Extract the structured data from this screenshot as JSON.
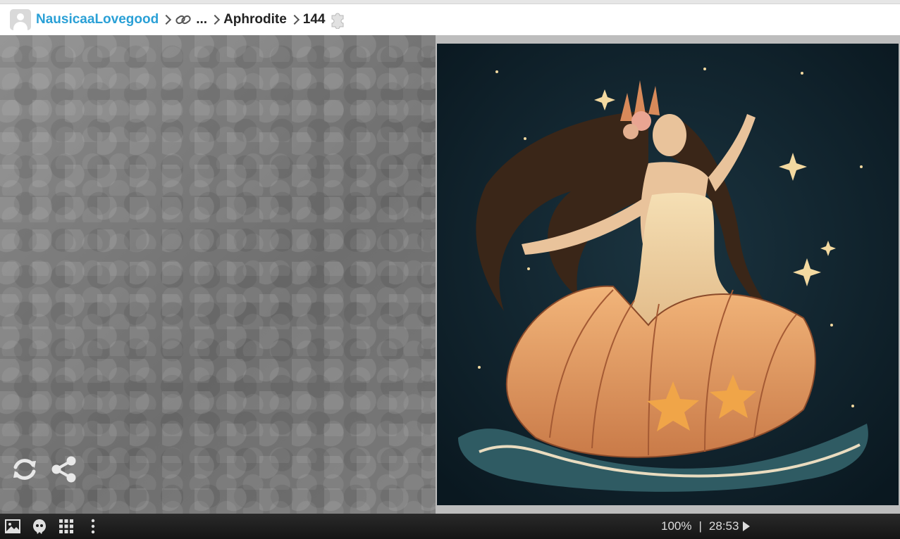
{
  "breadcrumb": {
    "user": "NausicaaLovegood",
    "ellipsis": "...",
    "puzzle_name": "Aphrodite",
    "piece_count": "144"
  },
  "puzzle": {
    "image_description_icon": "goddess-on-seashell-image"
  },
  "tools": {
    "shuffle_icon": "refresh-icon",
    "share_icon": "share-icon"
  },
  "bottombar": {
    "zoom": "100%",
    "separator": "|",
    "timer": "28:53",
    "icons": [
      "image-icon",
      "ghost-icon",
      "grid-icon",
      "more-icon"
    ]
  },
  "colors": {
    "user_link": "#2aa0d6",
    "bar_bg": "#1e1e1e",
    "image_bg": "#0f2029"
  }
}
